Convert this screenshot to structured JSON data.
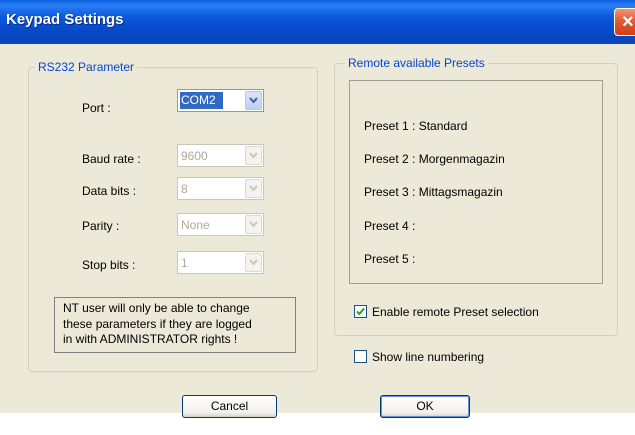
{
  "window": {
    "title": "Keypad Settings",
    "close_glyph": "×"
  },
  "rs232": {
    "legend": "RS232 Parameter",
    "port": {
      "label": "Port :",
      "value": "COM2"
    },
    "baud": {
      "label": "Baud rate :",
      "value": "9600"
    },
    "databits": {
      "label": "Data bits :",
      "value": "8"
    },
    "parity": {
      "label": "Parity :",
      "value": "None"
    },
    "stopbits": {
      "label": "Stop bits :",
      "value": "1"
    },
    "note_lines": [
      "NT user will only be able to change",
      "these parameters if they are logged",
      "in with ADMINISTRATOR rights !"
    ]
  },
  "presets": {
    "legend": "Remote available Presets",
    "items": [
      "Preset 1 : Standard",
      "Preset 2 : Morgenmagazin",
      "Preset 3 : Mittagsmagazin",
      "Preset 4 :",
      "Preset 5 :"
    ],
    "enable_remote": {
      "label": "Enable remote Preset selection",
      "checked": true
    },
    "show_line_numbering": {
      "label": "Show line numbering",
      "checked": false
    }
  },
  "buttons": {
    "cancel": "Cancel",
    "ok": "OK"
  },
  "colors": {
    "titlebar": "#0a5fe0",
    "dialog_bg": "#ece9d8",
    "legend_text": "#0046d5",
    "selection": "#316ac5"
  }
}
